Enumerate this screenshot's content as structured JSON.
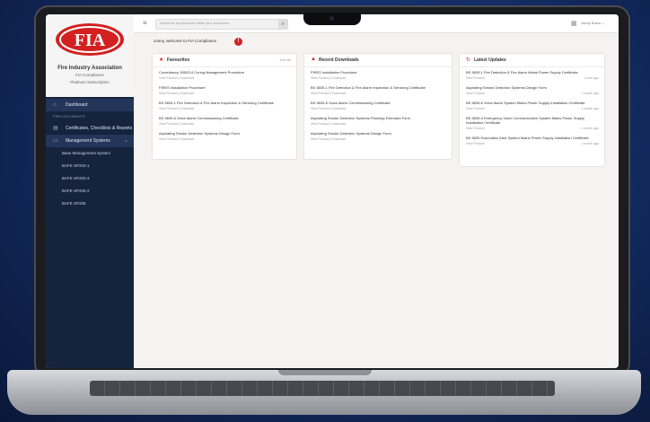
{
  "brand": {
    "name": "Fire Industry Association",
    "subtitle": "FIA Compliance",
    "tagline": "Platinum Subscription",
    "logo_text": "FIA",
    "logo_color": "#d32020"
  },
  "topbar": {
    "search_placeholder": "Search for any document within your documents",
    "user_label": "Jonny Bravo"
  },
  "sidebar": {
    "items": [
      {
        "label": "Dashboard",
        "icon": "home-icon"
      },
      {
        "label": "Certificates, Checklists & Reports",
        "icon": "document-icon"
      },
      {
        "label": "Management Systems",
        "icon": "folder-icon"
      }
    ],
    "section_label": "Fire Documents",
    "sub_items": [
      "Base Management System",
      "BAFE SP203-1",
      "BAFE SP203-3",
      "BAFE SP205-2",
      "BAFE SP206"
    ]
  },
  "welcome": "Jonny, welcome to FIA Compliance",
  "cards": {
    "favourites": {
      "title": "Favourites",
      "action": "See All",
      "rows": [
        {
          "title": "Consultancy, BS8214 Coring Management Procedure",
          "meta": "View Product  |  Download"
        },
        {
          "title": "FIRES Installation Procedure",
          "meta": "View Product  |  Download"
        },
        {
          "title": "BS 5839-1 Fire Detection & Fire Alarm Inspection & Servicing Certificate",
          "meta": "View Product  |  Download"
        },
        {
          "title": "BS 5839-6 Voice Alarm Commissioning Certificate",
          "meta": "View Product  |  Download"
        },
        {
          "title": "Aspirating Smoke Detection Systems Design Form",
          "meta": "View Product  |  Download"
        }
      ]
    },
    "recent": {
      "title": "Recent Downloads",
      "rows": [
        {
          "title": "FIRES Installation Procedure",
          "meta": "View Product  |  Download"
        },
        {
          "title": "BS 5839-1 Fire Detection & Fire Alarm Inspection & Servicing Certificate",
          "meta": "View Product  |  Download"
        },
        {
          "title": "BS 5839-8 Voice Alarm Commissioning Certificate",
          "meta": "View Product  |  Download"
        },
        {
          "title": "Aspirating Smoke Detection Systems Planning Extended Form",
          "meta": "View Product  |  Download"
        },
        {
          "title": "Aspirating Smoke Detection Systems Design Form",
          "meta": "View Product  |  Download"
        }
      ]
    },
    "updates": {
      "title": "Latest Updates",
      "rows": [
        {
          "title": "BS 5839-1 Fire Detection & Fire Alarm Mains Power Supply Certificate",
          "meta": "View Product",
          "time": "1 hour ago"
        },
        {
          "title": "Aspirating Smoke Detection Systems Design Form",
          "meta": "View Product",
          "time": "1 month ago"
        },
        {
          "title": "BS 5839-6 Voice Alarm System Mains Power Supply Installation Certificate",
          "meta": "View Product",
          "time": "1 month ago"
        },
        {
          "title": "BS 5839-9 Emergency Voice Communication System Mains Power Supply Installation Certificate",
          "meta": "View Product",
          "time": "1 month ago"
        },
        {
          "title": "BS 5839 Evacuation Alert System Mains Power Supply Installation Certificate",
          "meta": "View Product",
          "time": "1 month ago"
        }
      ]
    }
  }
}
